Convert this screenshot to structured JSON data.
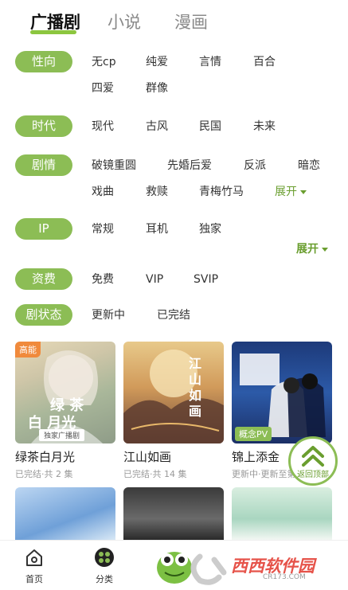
{
  "top_tabs": [
    "广播剧",
    "小说",
    "漫画"
  ],
  "filters": {
    "xingxiang": {
      "label": "性向",
      "options": [
        "无cp",
        "纯爱",
        "言情",
        "百合",
        "四爱",
        "群像"
      ]
    },
    "shidai": {
      "label": "时代",
      "options": [
        "现代",
        "古风",
        "民国",
        "未来"
      ]
    },
    "juqing": {
      "label": "剧情",
      "options": [
        "破镜重圆",
        "先婚后爱",
        "反派",
        "暗恋",
        "戏曲",
        "救赎",
        "青梅竹马"
      ],
      "expand": "展开"
    },
    "ip": {
      "label": "IP",
      "options": [
        "常规",
        "耳机",
        "独家"
      ],
      "expand": "展开"
    },
    "zifei": {
      "label": "资费",
      "options": [
        "免费",
        "VIP",
        "SVIP"
      ]
    },
    "juzhuangtai": {
      "label": "剧状态",
      "options": [
        "更新中",
        "已完结"
      ]
    }
  },
  "cards": [
    {
      "title": "绿茶白月光",
      "meta": "已完结·共 2 集",
      "badge": "高能",
      "cover_text_1": "绿 茶",
      "cover_text_2": "白 月光",
      "cover_sub": "独家广播剧"
    },
    {
      "title": "江山如画",
      "meta": "已完结·共 14 集",
      "cover_text_1": "江山如画"
    },
    {
      "title": "锦上添金",
      "meta": "更新中·更新至第…",
      "badge": "概念PV"
    }
  ],
  "back_to_top": "返回顶部",
  "bottom_nav": [
    "首页",
    "分类"
  ],
  "watermark": {
    "main": "西西软件园",
    "sub": "CR173.COM"
  },
  "colors": {
    "accent": "#8cbd55",
    "accent_dark": "#6a9e2f",
    "badge_orange": "#f08a3c"
  }
}
